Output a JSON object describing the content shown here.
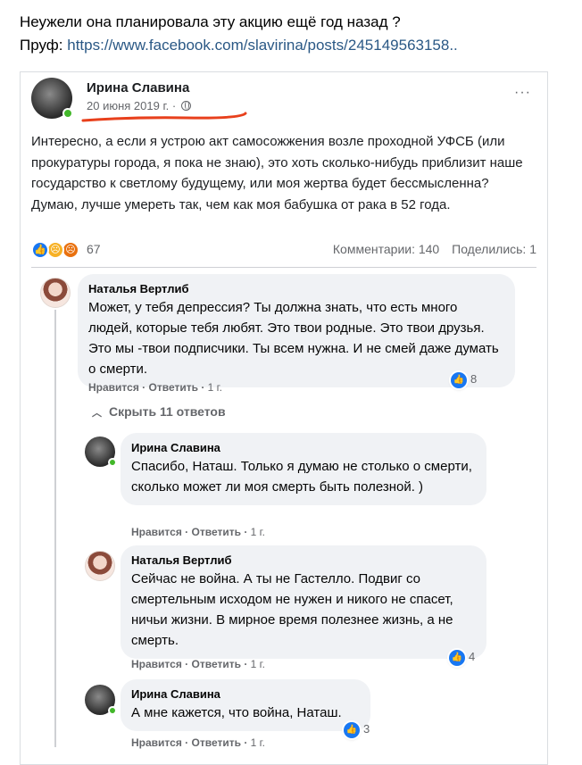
{
  "caption": {
    "question": "Неужели она планировала эту акцию ещё год назад ?",
    "proof_label": "Пруф:",
    "proof_link": "https://www.facebook.com/slavirina/posts/245149563158.."
  },
  "post": {
    "author": "Ирина Славина",
    "date": "20 июня 2019 г.",
    "date_separator": "·",
    "more": "···",
    "text": "Интересно, а если я устрою акт самосожжения возле проходной УФСБ (или прокуратуры города, я пока не знаю), это хоть сколько-нибудь приблизит наше государство к светлому будущему, или моя жертва будет бессмысленна? Думаю, лучше умереть так, чем как моя бабушка от рака в 52 года.",
    "reactions_count": "67",
    "comments": "Комментарии: 140",
    "shares": "Поделились: 1"
  },
  "colors": {
    "accent": "#1877f2",
    "link": "#2a5885",
    "underline": "#e8401c",
    "online": "#42b72a"
  },
  "comments": [
    {
      "name": "Наталья Вертлиб",
      "text": "Может, у тебя депрессия? Ты должна знать, что есть много людей, которые тебя любят. Это твои родные. Это твои друзья. Это мы -твои подписчики. Ты всем нужна. И не смей даже думать о смерти.",
      "like": "Нравится",
      "reply": "Ответить",
      "time": "1 г.",
      "likes": "8"
    }
  ],
  "hide_replies": "Скрыть 11 ответов",
  "replies": [
    {
      "name": "Ирина Славина",
      "text": "Спасибо, Наташ. Только я думаю не столько о смерти, сколько может ли моя смерть быть полезной. )",
      "like": "Нравится",
      "reply": "Ответить",
      "time": "1 г."
    },
    {
      "name": "Наталья Вертлиб",
      "text": "Сейчас не война. А ты не Гастелло. Подвиг со смертельным исходом не нужен и никого не спасет, ничьи жизни. В мирное время полезнее жизнь, а не смерть.",
      "like": "Нравится",
      "reply": "Ответить",
      "time": "1 г.",
      "likes": "4"
    },
    {
      "name": "Ирина Славина",
      "text": "А мне кажется, что война, Наташ.",
      "like": "Нравится",
      "reply": "Ответить",
      "time": "1 г.",
      "likes": "3"
    }
  ],
  "separator": "·",
  "icons": [
    "more-icon",
    "globe-icon",
    "like-reaction-icon",
    "sad-reaction-icon",
    "angry-reaction-icon",
    "chevron-up-icon",
    "like-badge-icon"
  ]
}
